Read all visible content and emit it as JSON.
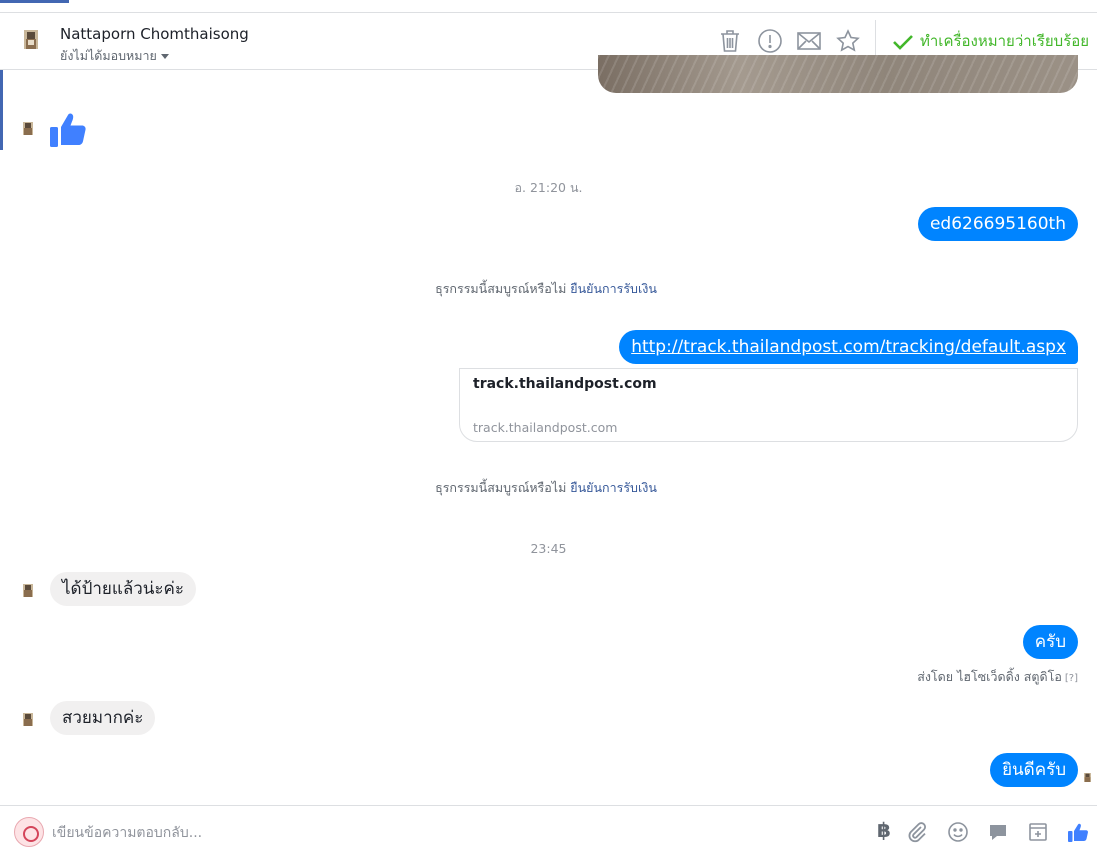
{
  "header": {
    "name": "Nattaporn Chomthaisong",
    "assign_label": "ยังไม่ได้มอบหมาย",
    "mark_done_label": "ทำเครื่องหมายว่าเรียบร้อย",
    "icons": [
      "trash-icon",
      "report-icon",
      "mail-icon",
      "star-icon",
      "checkmark-icon"
    ]
  },
  "conversation": {
    "timestamp_1": "อ. 21:20 น.",
    "timestamp_2": "23:45",
    "tracking_message": "ed626695160th",
    "transaction": {
      "question": "ธุรกรรมนี้สมบูรณ์หรือไม่",
      "confirm_link": "ยืนยันการรับเงิน"
    },
    "link_message": "http://track.thailandpost.com/tracking/default.aspx",
    "link_preview": {
      "title": "track.thailandpost.com",
      "domain": "track.thailandpost.com"
    },
    "incoming_1": "ได้ป้ายแล้วน่ะค่ะ",
    "outgoing_1": "ครับ",
    "sent_by": "ส่งโดย ไฮโซเว็ดดิ้ง สตูดิโอ",
    "sent_by_help": "[?]",
    "incoming_2": "สวยมากค่ะ",
    "outgoing_2": "ยินดีครับ"
  },
  "composer": {
    "placeholder": "เขียนข้อความตอบกลับ...",
    "baht_symbol": "฿",
    "icons": [
      "attach-icon",
      "emoji-icon",
      "saved-reply-icon",
      "appointment-icon",
      "like-icon"
    ]
  },
  "colors": {
    "accent": "#0084ff",
    "done_green": "#42b72a",
    "link_blue": "#365899",
    "incoming_bubble": "#f1f0f0"
  }
}
